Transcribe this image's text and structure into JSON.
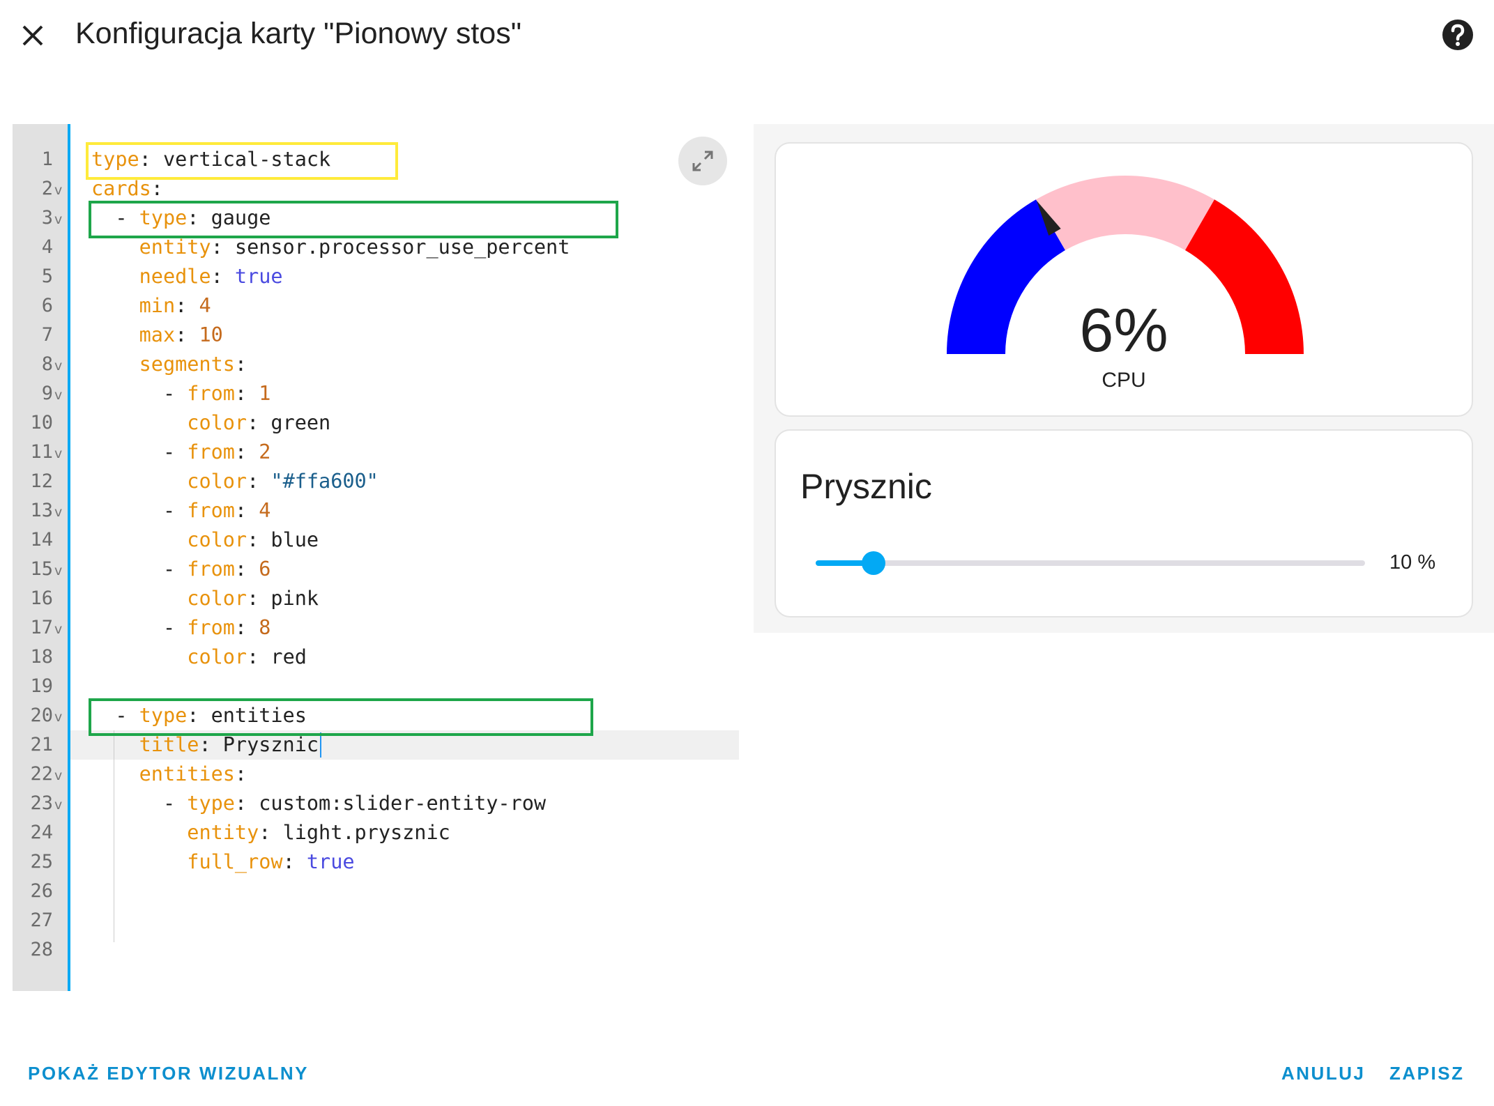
{
  "dialog": {
    "title": "Konfiguracja karty \"Pionowy stos\"",
    "close_icon": "close-icon",
    "help_icon": "help-circle-icon"
  },
  "editor": {
    "expand_icon": "expand-arrows-icon",
    "lines": [
      {
        "n": "1",
        "fold": false,
        "indent": 0,
        "key": "type",
        "value": "vertical-stack",
        "value_type": "plain"
      },
      {
        "n": "2",
        "fold": true,
        "indent": 0,
        "key": "cards",
        "value": "",
        "value_type": "plain"
      },
      {
        "n": "3",
        "fold": true,
        "indent": 2,
        "dash": true,
        "key": "type",
        "value": "gauge",
        "value_type": "plain"
      },
      {
        "n": "4",
        "fold": false,
        "indent": 4,
        "key": "entity",
        "value": "sensor.processor_use_percent",
        "value_type": "plain"
      },
      {
        "n": "5",
        "fold": false,
        "indent": 4,
        "key": "needle",
        "value": "true",
        "value_type": "bool"
      },
      {
        "n": "6",
        "fold": false,
        "indent": 4,
        "key": "min",
        "value": "4",
        "value_type": "number"
      },
      {
        "n": "7",
        "fold": false,
        "indent": 4,
        "key": "max",
        "value": "10",
        "value_type": "number"
      },
      {
        "n": "8",
        "fold": true,
        "indent": 4,
        "key": "segments",
        "value": "",
        "value_type": "plain"
      },
      {
        "n": "9",
        "fold": true,
        "indent": 6,
        "dash": true,
        "key": "from",
        "value": "1",
        "value_type": "number"
      },
      {
        "n": "10",
        "fold": false,
        "indent": 8,
        "key": "color",
        "value": "green",
        "value_type": "plain"
      },
      {
        "n": "11",
        "fold": true,
        "indent": 6,
        "dash": true,
        "key": "from",
        "value": "2",
        "value_type": "number"
      },
      {
        "n": "12",
        "fold": false,
        "indent": 8,
        "key": "color",
        "value": "\"#ffa600\"",
        "value_type": "string"
      },
      {
        "n": "13",
        "fold": true,
        "indent": 6,
        "dash": true,
        "key": "from",
        "value": "4",
        "value_type": "number"
      },
      {
        "n": "14",
        "fold": false,
        "indent": 8,
        "key": "color",
        "value": "blue",
        "value_type": "plain"
      },
      {
        "n": "15",
        "fold": true,
        "indent": 6,
        "dash": true,
        "key": "from",
        "value": "6",
        "value_type": "number"
      },
      {
        "n": "16",
        "fold": false,
        "indent": 8,
        "key": "color",
        "value": "pink",
        "value_type": "plain"
      },
      {
        "n": "17",
        "fold": true,
        "indent": 6,
        "dash": true,
        "key": "from",
        "value": "8",
        "value_type": "number"
      },
      {
        "n": "18",
        "fold": false,
        "indent": 8,
        "key": "color",
        "value": "red",
        "value_type": "plain"
      },
      {
        "n": "19",
        "fold": false,
        "indent": 0,
        "key": "",
        "value": "",
        "value_type": "plain"
      },
      {
        "n": "20",
        "fold": true,
        "indent": 2,
        "dash": true,
        "key": "type",
        "value": "entities",
        "value_type": "plain"
      },
      {
        "n": "21",
        "fold": false,
        "indent": 4,
        "key": "title",
        "value": "Prysznic",
        "value_type": "plain",
        "active": true
      },
      {
        "n": "22",
        "fold": true,
        "indent": 4,
        "key": "entities",
        "value": "",
        "value_type": "plain"
      },
      {
        "n": "23",
        "fold": true,
        "indent": 6,
        "dash": true,
        "key": "type",
        "value": "custom:slider-entity-row",
        "value_type": "plain"
      },
      {
        "n": "24",
        "fold": false,
        "indent": 8,
        "key": "entity",
        "value": "light.prysznic",
        "value_type": "plain"
      },
      {
        "n": "25",
        "fold": false,
        "indent": 8,
        "key": "full_row",
        "value": "true",
        "value_type": "bool"
      },
      {
        "n": "26",
        "fold": false,
        "indent": 0,
        "key": "",
        "value": "",
        "value_type": "plain"
      },
      {
        "n": "27",
        "fold": false,
        "indent": 0,
        "key": "",
        "value": "",
        "value_type": "plain"
      },
      {
        "n": "28",
        "fold": false,
        "indent": 0,
        "key": "",
        "value": "",
        "value_type": "plain"
      }
    ],
    "highlights": [
      {
        "lines": "1",
        "color": "#ffeb3b"
      },
      {
        "lines": "3",
        "color": "#1ea64a"
      },
      {
        "lines": "20",
        "color": "#1ea64a"
      }
    ]
  },
  "preview": {
    "gauge": {
      "value_text": "6%",
      "name": "CPU",
      "value": 6,
      "min": 4,
      "max": 10,
      "needle": true,
      "segments": [
        {
          "from": 4,
          "to": 6,
          "color": "#0000ff"
        },
        {
          "from": 6,
          "to": 8,
          "color": "#ffc0cb"
        },
        {
          "from": 8,
          "to": 10,
          "color": "#ff0000"
        }
      ],
      "needle_color": "#212121"
    },
    "entities_card": {
      "title": "Prysznic",
      "slider": {
        "value": 10,
        "value_text": "10 %",
        "accent": "#03a9f4",
        "track": "#dfdde3"
      }
    }
  },
  "footer": {
    "visual_editor_label": "POKAŻ EDYTOR WIZUALNY",
    "cancel_label": "ANULUJ",
    "save_label": "ZAPISZ",
    "accent": "#0d8fce"
  }
}
